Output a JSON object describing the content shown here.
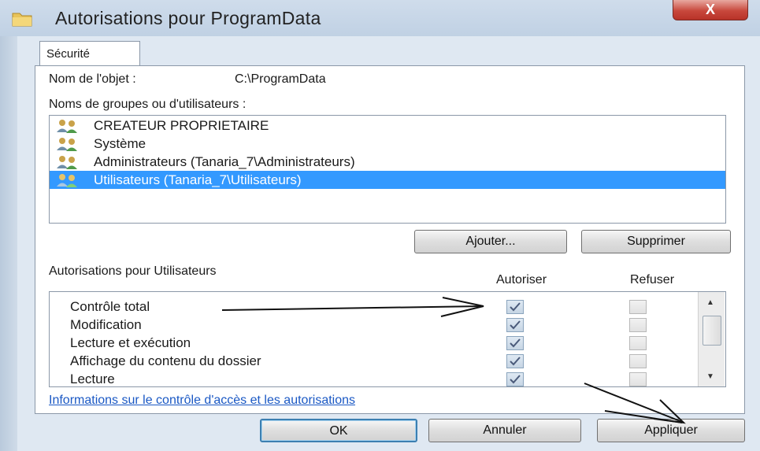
{
  "window": {
    "title": "Autorisations pour ProgramData",
    "close_label": "X"
  },
  "tab": {
    "label": "Sécurité"
  },
  "object": {
    "label": "Nom de l'objet :",
    "value": "C:\\ProgramData"
  },
  "groups": {
    "label": "Noms de groupes ou d'utilisateurs :",
    "items": [
      {
        "label": "CREATEUR PROPRIETAIRE",
        "selected": false
      },
      {
        "label": "Système",
        "selected": false
      },
      {
        "label": "Administrateurs (Tanaria_7\\Administrateurs)",
        "selected": false
      },
      {
        "label": "Utilisateurs (Tanaria_7\\Utilisateurs)",
        "selected": true
      }
    ],
    "add_button": "Ajouter...",
    "remove_button": "Supprimer"
  },
  "permissions": {
    "label": "Autorisations pour Utilisateurs",
    "col_allow": "Autoriser",
    "col_deny": "Refuser",
    "rows": [
      {
        "label": "Contrôle total",
        "allow": true,
        "deny": false
      },
      {
        "label": "Modification",
        "allow": true,
        "deny": false
      },
      {
        "label": "Lecture et exécution",
        "allow": true,
        "deny": false
      },
      {
        "label": "Affichage du contenu du dossier",
        "allow": true,
        "deny": false
      },
      {
        "label": "Lecture",
        "allow": true,
        "deny": false
      }
    ]
  },
  "link": {
    "label": "Informations sur le contrôle d'accès et les autorisations"
  },
  "footer": {
    "ok": "OK",
    "cancel": "Annuler",
    "apply": "Appliquer"
  },
  "colors": {
    "selection": "#3399ff",
    "link": "#1a58c4",
    "close": "#c8483c"
  }
}
